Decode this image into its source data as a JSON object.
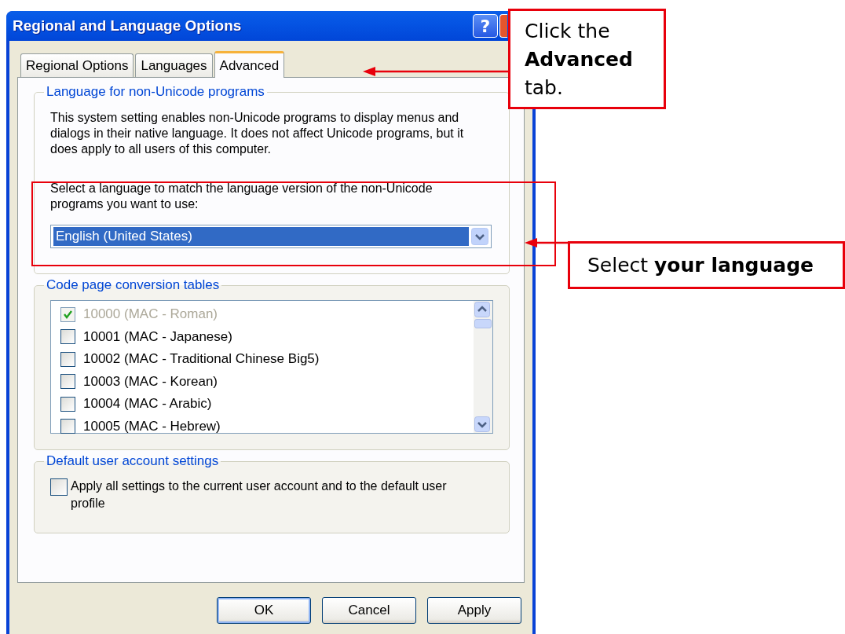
{
  "window": {
    "title": "Regional and Language Options",
    "help_button": "?"
  },
  "tabs": [
    {
      "label": "Regional Options",
      "selected": false
    },
    {
      "label": "Languages",
      "selected": false
    },
    {
      "label": "Advanced",
      "selected": true
    }
  ],
  "non_unicode_group": {
    "title": "Language for non-Unicode programs",
    "description": "This system setting enables non-Unicode programs to display menus and dialogs in their native language. It does not affect Unicode programs, but it does apply to all users of this computer.",
    "prompt": "Select a language to match the language version of the non-Unicode programs you want to use:",
    "language": "English (United States)"
  },
  "code_page_group": {
    "title": "Code page conversion tables",
    "items": [
      {
        "label": "10000 (MAC - Roman)",
        "checked": true,
        "disabled": true
      },
      {
        "label": "10001 (MAC - Japanese)",
        "checked": false,
        "disabled": false
      },
      {
        "label": "10002 (MAC - Traditional Chinese Big5)",
        "checked": false,
        "disabled": false
      },
      {
        "label": "10003 (MAC - Korean)",
        "checked": false,
        "disabled": false
      },
      {
        "label": "10004 (MAC - Arabic)",
        "checked": false,
        "disabled": false
      },
      {
        "label": "10005 (MAC - Hebrew)",
        "checked": false,
        "disabled": false
      }
    ]
  },
  "default_user_group": {
    "title": "Default user account settings",
    "option": {
      "label": "Apply all settings to the current user account and to the default user profile",
      "checked": false
    }
  },
  "buttons": [
    {
      "label": "OK",
      "default": true
    },
    {
      "label": "Cancel",
      "default": false
    },
    {
      "label": "Apply",
      "default": false
    }
  ],
  "callouts": [
    {
      "text": "Click the **Advanced** tab."
    },
    {
      "text": "Select **your language**"
    }
  ]
}
